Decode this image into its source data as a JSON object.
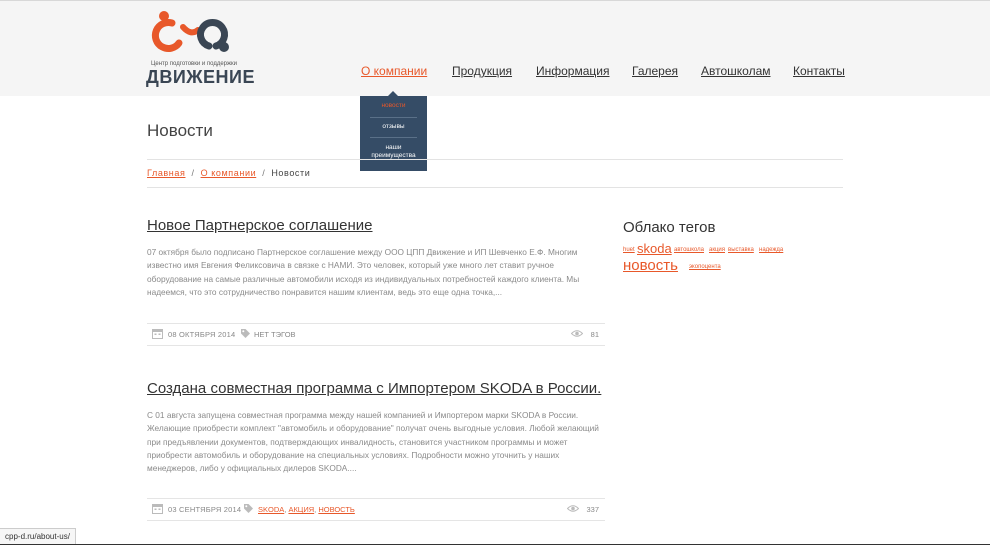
{
  "logo": {
    "tagline": "Центр подготовки и поддержки",
    "name": "ДВИЖЕНИЕ"
  },
  "nav": [
    {
      "label": "О компании",
      "active": true
    },
    {
      "label": "Продукция"
    },
    {
      "label": "Информация"
    },
    {
      "label": "Галерея"
    },
    {
      "label": "Автошколам"
    },
    {
      "label": "Контакты"
    }
  ],
  "dropdown": [
    {
      "label": "новости",
      "active": true
    },
    {
      "label": "отзывы"
    },
    {
      "label": "наши преимущества"
    }
  ],
  "page": {
    "title": "Новости"
  },
  "breadcrumb": {
    "home": "Главная",
    "section": "О компании",
    "current": "Новости",
    "separator": "/"
  },
  "posts": [
    {
      "title": "Новое Партнерское соглашение",
      "excerpt": "07 октября было подписано Партнерское соглашение между ООО ЦПП Движение и ИП Шевченко Е.Ф. Многим известно имя Евгения Феликсовича в связке с НАМИ. Это человек, который уже много лет ставит ручное оборудование на самые различные автомобили исходя из индивидуальных потребностей каждого клиента. Мы надеемся, что это сотрудничество понравится нашим клиентам, ведь это еще одна точка,...",
      "date": "08 ОКТЯБРЯ 2014",
      "no_tags": "НЕТ ТЭГОВ",
      "views": "81"
    },
    {
      "title": "Создана совместная программа с Импортером SKODA в России.",
      "excerpt": "С 01 августа запущена совместная программа между нашей компанией и Импортером марки SKODA в России. Желающие приобрести комплект \"автомобиль и оборудование\" получат очень выгодные условия. Любой желающий при предъявлении документов, подтверждающих инвалидность, становится участником программы и может приобрести автомобиль и оборудование на специальных условиях. Подробности можно уточнить у наших менеджеров, либо у официальных дилеров SKODA....",
      "date": "03 СЕНТЯБРЯ 2014",
      "tags": [
        "SKODA",
        "АКЦИЯ",
        "НОВОСТЬ"
      ],
      "views": "337"
    }
  ],
  "tag_cloud": {
    "title": "Облако тегов",
    "tags": [
      "huet",
      "skoda",
      "автошкола",
      "акция",
      "выставка",
      "надежда",
      "новость",
      "экопоцента"
    ]
  },
  "statusbar": {
    "url": "cpp-d.ru/about-us/"
  },
  "colors": {
    "accent": "#e8582a",
    "dropdown_bg": "#354c66",
    "logo_dark": "#3a4654"
  },
  "icons": {
    "date": "calendar-icon",
    "tags": "tag-icon",
    "views": "eye-icon"
  }
}
